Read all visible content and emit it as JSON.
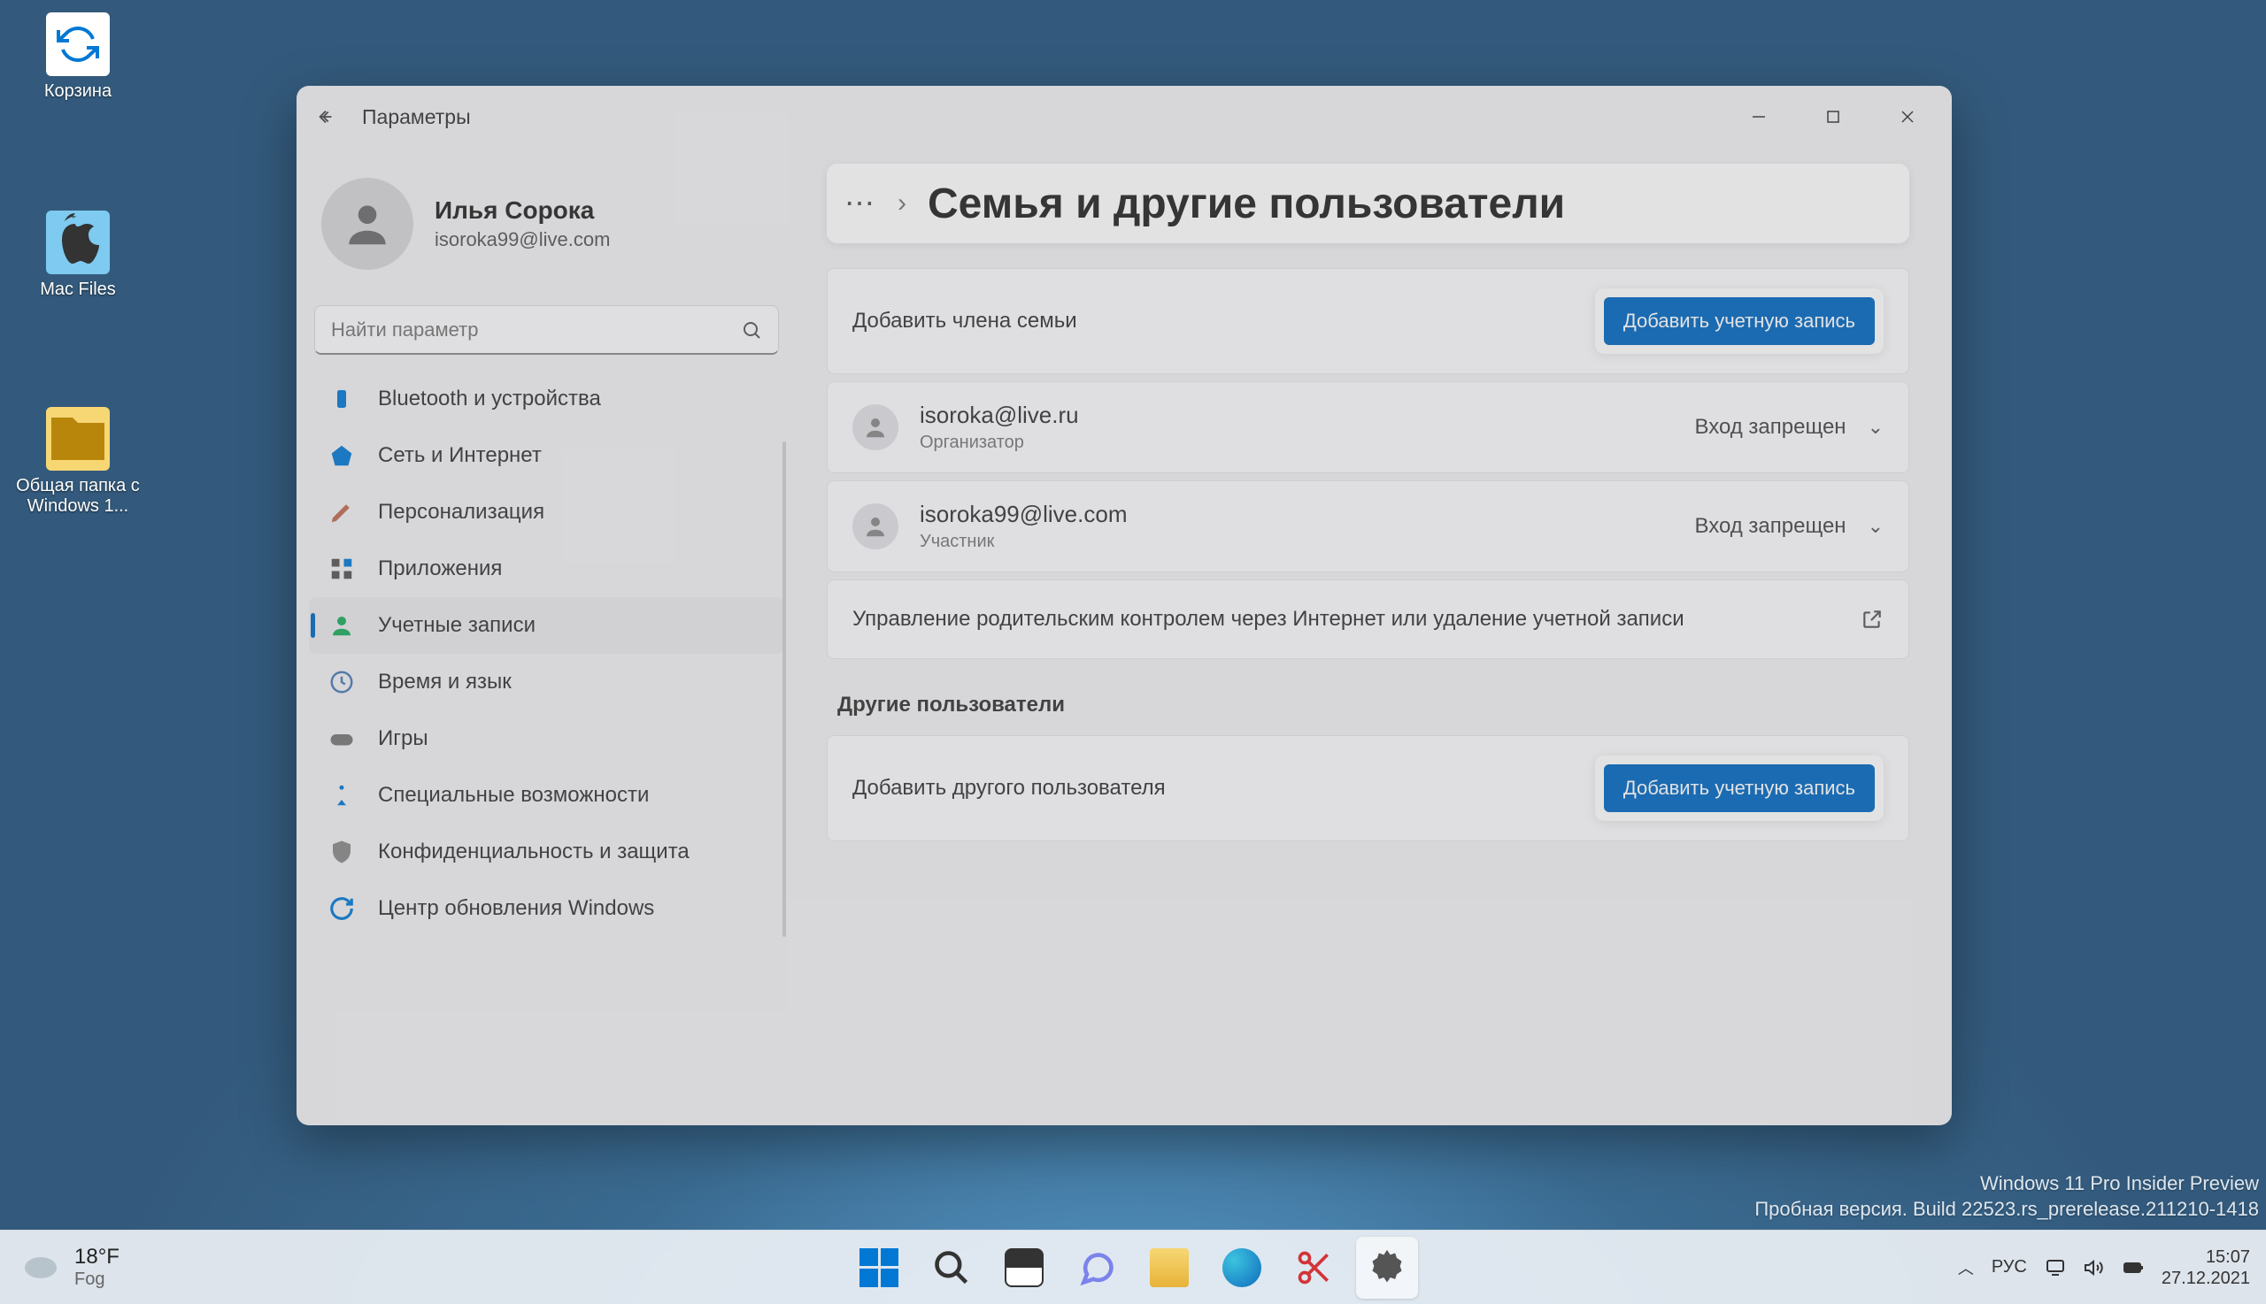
{
  "desktop": {
    "icons": {
      "recycle": "Корзина",
      "macfiles": "Mac Files",
      "shared": "Общая папка с Windows 1..."
    },
    "watermark_line1": "Windows 11 Pro Insider Preview",
    "watermark_line2": "Пробная версия. Build 22523.rs_prerelease.211210-1418"
  },
  "window": {
    "title": "Параметры",
    "profile": {
      "name": "Илья Сорока",
      "email": "isoroka99@live.com"
    },
    "search_placeholder": "Найти параметр",
    "nav": [
      "Bluetooth и устройства",
      "Сеть и Интернет",
      "Персонализация",
      "Приложения",
      "Учетные записи",
      "Время и язык",
      "Игры",
      "Специальные возможности",
      "Конфиденциальность и защита",
      "Центр обновления Windows"
    ],
    "crumb_title": "Семья и другие пользователи",
    "add_family_label": "Добавить члена семьи",
    "add_account_btn": "Добавить учетную запись",
    "family": [
      {
        "email": "isoroka@live.ru",
        "role": "Организатор",
        "status": "Вход запрещен"
      },
      {
        "email": "isoroka99@live.com",
        "role": "Участник",
        "status": "Вход запрещен"
      }
    ],
    "parental_text": "Управление родительским контролем через Интернет или удаление учетной записи",
    "other_section": "Другие пользователи",
    "add_other_label": "Добавить другого пользователя"
  },
  "taskbar": {
    "weather_temp": "18°F",
    "weather_cond": "Fog",
    "lang": "РУС",
    "time": "15:07",
    "date": "27.12.2021"
  }
}
